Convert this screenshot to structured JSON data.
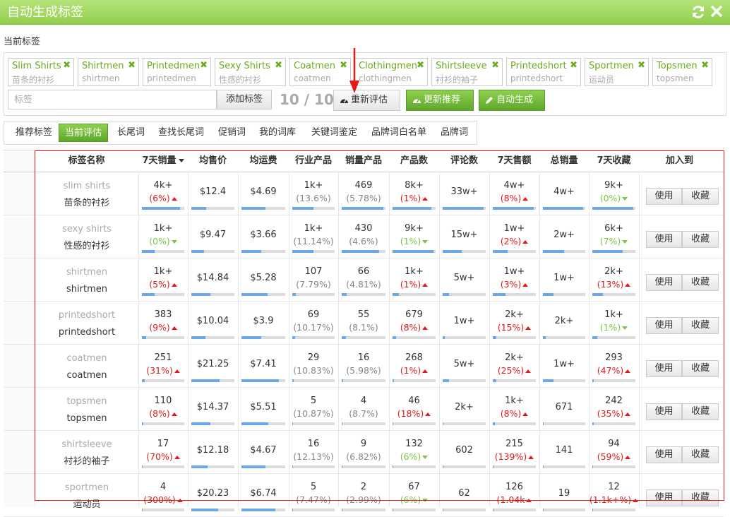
{
  "window": {
    "title": "自动生成标签"
  },
  "section_label": "当前标签",
  "tags": [
    {
      "en": "Slim Shirts",
      "cn": "苗条的衬衫"
    },
    {
      "en": "Shirtmen",
      "cn": "shirtmen"
    },
    {
      "en": "Printedmen",
      "cn": "printedmen"
    },
    {
      "en": "Sexy Shirts",
      "cn": "性感的衬衫"
    },
    {
      "en": "Coatmen",
      "cn": "coatmen"
    },
    {
      "en": "Clothingmen",
      "cn": "clothingmen"
    },
    {
      "en": "Shirtsleeve",
      "cn": "衬衫的袖子"
    },
    {
      "en": "Printedshort",
      "cn": "printedshort"
    },
    {
      "en": "Sportmen",
      "cn": "运动员"
    },
    {
      "en": "Topsmen",
      "cn": "topsmen"
    }
  ],
  "tag_input": {
    "placeholder": "标签"
  },
  "buttons": {
    "add": "添加标签",
    "counter": "10 / 10",
    "reeval": "重新评估",
    "recommend": "更新推荐",
    "auto": "自动生成"
  },
  "tabs": [
    "推荐标签",
    "当前评估",
    "长尾词",
    "查找长尾词",
    "促销词",
    "我的词库",
    "关键词鉴定",
    "品牌词白名单",
    "品牌词"
  ],
  "active_tab": "当前评估",
  "table": {
    "headers": [
      "标签名称",
      "7天销量",
      "均售价",
      "均运费",
      "行业产品",
      "销量产品",
      "产品数",
      "评论数",
      "7天售额",
      "总销量",
      "7天收藏",
      "加入到"
    ],
    "use_label": "使用",
    "fav_label": "收藏",
    "rows": [
      {
        "en": "slim shirts",
        "cn": "苗条的衬衫",
        "sales7": "4k+",
        "sales7_pct": "(6%)",
        "sales7_trend": "up",
        "sales7_bar": 0.9,
        "avg_price": "$12.4",
        "avg_price_bar": 0.35,
        "avg_ship": "$4.69",
        "avg_ship_bar": 0.55,
        "ind": "1k+",
        "ind_pct": "(13.6%)",
        "ind_bar": 0.5,
        "sold": "469",
        "sold_pct": "(5.78%)",
        "sold_bar": 0.95,
        "prod": "8k+",
        "prod_pct": "(1%)",
        "prod_trend": "up",
        "prod_bar": 0.9,
        "reviews": "33w+",
        "reviews_bar": 0.95,
        "rev7": "4w+",
        "rev7_pct": "(8%)",
        "rev7_trend": "up",
        "rev7_bar": 0.95,
        "total": "4w+",
        "total_bar": 0.95,
        "fav7": "9k+",
        "fav7_pct": "(0%)",
        "fav7_trend": "down",
        "fav7_bar": 0.95
      },
      {
        "en": "sexy shirts",
        "cn": "性感的衬衫",
        "sales7": "1k+",
        "sales7_pct": "(0%)",
        "sales7_trend": "down",
        "sales7_bar": 0.3,
        "avg_price": "$9.47",
        "avg_price_bar": 0.3,
        "avg_ship": "$3.66",
        "avg_ship_bar": 0.45,
        "ind": "1k+",
        "ind_pct": "(11.14%)",
        "ind_bar": 0.5,
        "sold": "430",
        "sold_pct": "(4.6%)",
        "sold_bar": 0.85,
        "prod": "9k+",
        "prod_pct": "(1%)",
        "prod_trend": "down",
        "prod_bar": 0.95,
        "reviews": "15w+",
        "reviews_bar": 0.45,
        "rev7": "1w+",
        "rev7_pct": "(2%)",
        "rev7_trend": "up",
        "rev7_bar": 0.35,
        "total": "2w+",
        "total_bar": 0.5,
        "fav7": "6k+",
        "fav7_pct": "(7%)",
        "fav7_trend": "down",
        "fav7_bar": 0.7
      },
      {
        "en": "shirtmen",
        "cn": "shirtmen",
        "sales7": "1k+",
        "sales7_pct": "(5%)",
        "sales7_trend": "up",
        "sales7_bar": 0.3,
        "avg_price": "$14.84",
        "avg_price_bar": 0.45,
        "avg_ship": "$5.28",
        "avg_ship_bar": 0.6,
        "ind": "107",
        "ind_pct": "(7.79%)",
        "ind_bar": 0.08,
        "sold": "66",
        "sold_pct": "(4.81%)",
        "sold_bar": 0.12,
        "prod": "1k+",
        "prod_pct": "(1%)",
        "prod_trend": "up",
        "prod_bar": 0.15,
        "reviews": "5w+",
        "reviews_bar": 0.15,
        "rev7": "1w+",
        "rev7_pct": "(3%)",
        "rev7_trend": "up",
        "rev7_bar": 0.3,
        "total": "1w+",
        "total_bar": 0.25,
        "fav7": "2k+",
        "fav7_pct": "(13%)",
        "fav7_trend": "up",
        "fav7_bar": 0.25
      },
      {
        "en": "printedshort",
        "cn": "printedshort",
        "sales7": "383",
        "sales7_pct": "(9%)",
        "sales7_trend": "up",
        "sales7_bar": 0.1,
        "avg_price": "$10.04",
        "avg_price_bar": 0.32,
        "avg_ship": "$3.9",
        "avg_ship_bar": 0.45,
        "ind": "69",
        "ind_pct": "(10.17%)",
        "ind_bar": 0.06,
        "sold": "55",
        "sold_pct": "(8.1%)",
        "sold_bar": 0.1,
        "prod": "679",
        "prod_pct": "(8%)",
        "prod_trend": "up",
        "prod_bar": 0.08,
        "reviews": "1w+",
        "reviews_bar": 0.05,
        "rev7": "2k+",
        "rev7_pct": "(15%)",
        "rev7_trend": "up",
        "rev7_bar": 0.08,
        "total": "2k+",
        "total_bar": 0.06,
        "fav7": "1k+",
        "fav7_pct": "(1%)",
        "fav7_trend": "down",
        "fav7_bar": 0.12
      },
      {
        "en": "coatmen",
        "cn": "coatmen",
        "sales7": "251",
        "sales7_pct": "(31%)",
        "sales7_trend": "up",
        "sales7_bar": 0.07,
        "avg_price": "$21.25",
        "avg_price_bar": 0.65,
        "avg_ship": "$7.41",
        "avg_ship_bar": 0.85,
        "ind": "29",
        "ind_pct": "(10.83%)",
        "ind_bar": 0.03,
        "sold": "16",
        "sold_pct": "(5.98%)",
        "sold_bar": 0.04,
        "prod": "268",
        "prod_pct": "(1%)",
        "prod_trend": "up",
        "prod_bar": 0.04,
        "reviews": "5w+",
        "reviews_bar": 0.15,
        "rev7": "2k+",
        "rev7_pct": "(25%)",
        "rev7_trend": "up",
        "rev7_bar": 0.08,
        "total": "1w+",
        "total_bar": 0.25,
        "fav7": "293",
        "fav7_pct": "(47%)",
        "fav7_trend": "up",
        "fav7_bar": 0.04
      },
      {
        "en": "topsmen",
        "cn": "topsmen",
        "sales7": "110",
        "sales7_pct": "(8%)",
        "sales7_trend": "up",
        "sales7_bar": 0.04,
        "avg_price": "$14.37",
        "avg_price_bar": 0.45,
        "avg_ship": "$5.51",
        "avg_ship_bar": 0.62,
        "ind": "5",
        "ind_pct": "(10.87%)",
        "ind_bar": 0.01,
        "sold": "4",
        "sold_pct": "(8.7%)",
        "sold_bar": 0.01,
        "prod": "46",
        "prod_pct": "(18%)",
        "prod_trend": "up",
        "prod_bar": 0.01,
        "reviews": "2k+",
        "reviews_bar": 0.02,
        "rev7": "1k+",
        "rev7_pct": "(8%)",
        "rev7_trend": "up",
        "rev7_bar": 0.05,
        "total": "671",
        "total_bar": 0.02,
        "fav7": "242",
        "fav7_pct": "(35%)",
        "fav7_trend": "up",
        "fav7_bar": 0.03
      },
      {
        "en": "shirtsleeve",
        "cn": "衬衫的袖子",
        "sales7": "17",
        "sales7_pct": "(70%)",
        "sales7_trend": "up",
        "sales7_bar": 0.01,
        "avg_price": "$12.18",
        "avg_price_bar": 0.38,
        "avg_ship": "$4.67",
        "avg_ship_bar": 0.55,
        "ind": "16",
        "ind_pct": "(12.13%)",
        "ind_bar": 0.02,
        "sold": "9",
        "sold_pct": "(6.82%)",
        "sold_bar": 0.02,
        "prod": "132",
        "prod_pct": "(6%)",
        "prod_trend": "down",
        "prod_bar": 0.02,
        "reviews": "602",
        "reviews_bar": 0.01,
        "rev7": "215",
        "rev7_pct": "(139%)",
        "rev7_trend": "up",
        "rev7_bar": 0.01,
        "total": "141",
        "total_bar": 0.01,
        "fav7": "94",
        "fav7_pct": "(59%)",
        "fav7_trend": "up",
        "fav7_bar": 0.01
      },
      {
        "en": "sportmen",
        "cn": "运动员",
        "sales7": "4",
        "sales7_pct": "(300%)",
        "sales7_trend": "up",
        "sales7_bar": 0.01,
        "avg_price": "$20.23",
        "avg_price_bar": 0.62,
        "avg_ship": "$6.74",
        "avg_ship_bar": 0.78,
        "ind": "5",
        "ind_pct": "(7.47%)",
        "ind_bar": 0.01,
        "sold": "2",
        "sold_pct": "(2.99%)",
        "sold_bar": 0.01,
        "prod": "67",
        "prod_pct": "(6%)",
        "prod_trend": "down",
        "prod_bar": 0.01,
        "reviews": "62",
        "reviews_bar": 0.01,
        "rev7": "126",
        "rev7_pct": "(1.04k",
        "rev7_trend": "up",
        "rev7_bar": 0.01,
        "total": "19",
        "total_bar": 0.01,
        "fav7": "12",
        "fav7_pct": "(1.1k+%)",
        "fav7_trend": "up",
        "fav7_bar": 0.01
      }
    ]
  },
  "colors": {
    "accent_green": "#6aab21",
    "trend_up": "#e21a1a",
    "trend_down": "#7fc34c",
    "bar_fill": "#6aa8e8"
  }
}
